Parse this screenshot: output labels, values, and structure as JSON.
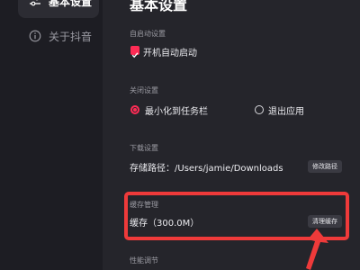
{
  "sidebar": {
    "items": [
      {
        "label": "基本设置",
        "icon": "sliders-icon",
        "active": true
      },
      {
        "label": "关于抖音",
        "icon": "info-icon",
        "active": false
      }
    ]
  },
  "main": {
    "title": "基本设置",
    "autostart": {
      "section_label": "自启动设置",
      "option_label": "开机自动启动",
      "checked": true
    },
    "close": {
      "section_label": "关闭设置",
      "options": [
        {
          "label": "最小化到任务栏",
          "selected": true
        },
        {
          "label": "退出应用",
          "selected": false
        }
      ]
    },
    "download": {
      "section_label": "下载设置",
      "path_label": "存储路径：/Users/jamie/Downloads",
      "button_label": "修改路径"
    },
    "cache": {
      "section_label": "缓存管理",
      "usage_label": "缓存（300.0M）",
      "button_label": "清理缓存"
    },
    "performance": {
      "section_label": "性能调节"
    }
  },
  "colors": {
    "accent": "#fe2c55",
    "annotation": "#ef3a3a",
    "sidebar_bg": "#1d1d23",
    "main_bg": "#25252b"
  }
}
